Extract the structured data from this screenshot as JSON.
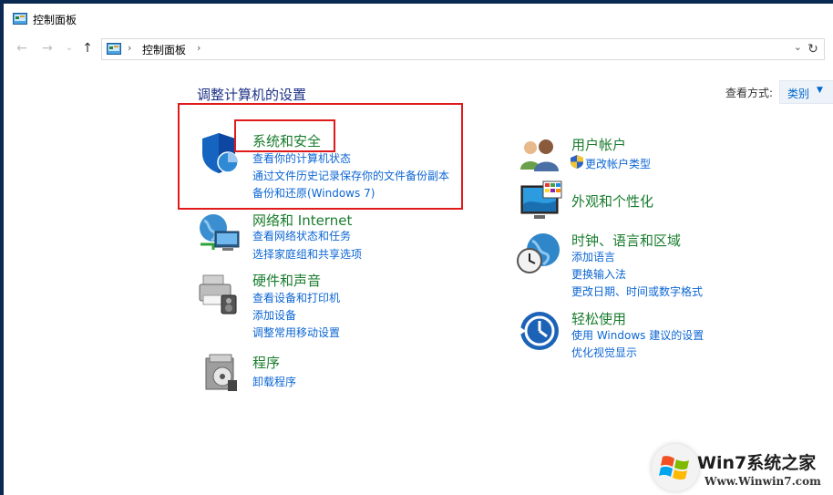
{
  "window": {
    "title": "控制面板"
  },
  "nav": {
    "back": "←",
    "forward": "→",
    "recent": "⌄",
    "up": "↑",
    "refresh": "↻"
  },
  "address": {
    "separator": "›",
    "crumb": "控制面板",
    "dropdown": "⌄"
  },
  "main": {
    "heading": "调整计算机的设置",
    "view_by_label": "查看方式:",
    "view_by_value": "类别"
  },
  "categories": {
    "system_security": {
      "title": "系统和安全",
      "links": [
        "查看你的计算机状态",
        "通过文件历史记录保存你的文件备份副本",
        "备份和还原(Windows 7)"
      ]
    },
    "network": {
      "title": "网络和 Internet",
      "links": [
        "查看网络状态和任务",
        "选择家庭组和共享选项"
      ]
    },
    "hardware": {
      "title": "硬件和声音",
      "links": [
        "查看设备和打印机",
        "添加设备",
        "调整常用移动设置"
      ]
    },
    "programs": {
      "title": "程序",
      "links": [
        "卸载程序"
      ]
    },
    "user_accounts": {
      "title": "用户帐户",
      "links": [
        "更改帐户类型"
      ]
    },
    "appearance": {
      "title": "外观和个性化",
      "links": []
    },
    "clock": {
      "title": "时钟、语言和区域",
      "links": [
        "添加语言",
        "更换输入法",
        "更改日期、时间或数字格式"
      ]
    },
    "ease": {
      "title": "轻松使用",
      "links": [
        "使用 Windows 建议的设置",
        "优化视觉显示"
      ]
    }
  },
  "watermark": {
    "title": "Win7系统之家",
    "url": "Www.Winwin7.com"
  },
  "colors": {
    "title_green": "#197c2d",
    "link_blue": "#0c66d3",
    "heading_blue": "#1e3287",
    "highlight_red": "#e01a1a"
  }
}
